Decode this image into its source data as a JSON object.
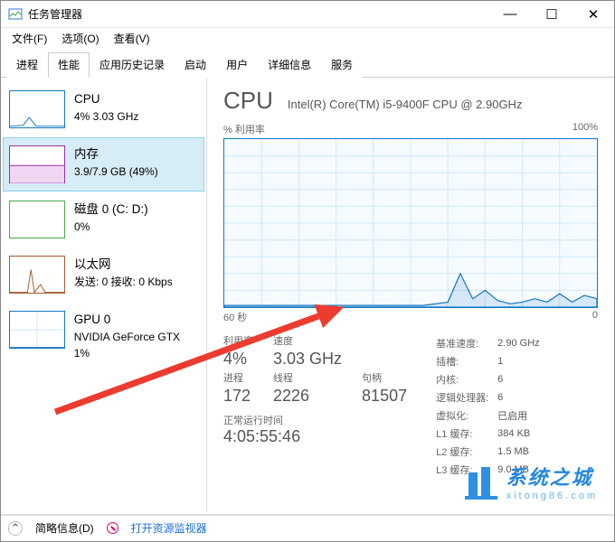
{
  "window": {
    "title": "任务管理器",
    "min": "—",
    "max": "☐",
    "close": "✕"
  },
  "menu": {
    "file": "文件(F)",
    "options": "选项(O)",
    "view": "查看(V)"
  },
  "tabs": [
    "进程",
    "性能",
    "应用历史记录",
    "启动",
    "用户",
    "详细信息",
    "服务"
  ],
  "active_tab": 1,
  "sidebar": [
    {
      "name": "CPU",
      "sub": "4% 3.03 GHz"
    },
    {
      "name": "内存",
      "sub": "3.9/7.9 GB (49%)"
    },
    {
      "name": "磁盘 0 (C: D:)",
      "sub": "0%"
    },
    {
      "name": "以太网",
      "sub": "发送: 0 接收: 0 Kbps"
    },
    {
      "name": "GPU 0",
      "sub": "NVIDIA GeForce GTX 1%"
    }
  ],
  "cpu": {
    "title": "CPU",
    "model": "Intel(R) Core(TM) i5-9400F CPU @ 2.90GHz",
    "util_label": "% 利用率",
    "util_max": "100%",
    "time_span": "60 秒",
    "time_zero": "0"
  },
  "stats": {
    "util_l": "利用率",
    "util_v": "4%",
    "speed_l": "速度",
    "speed_v": "3.03 GHz",
    "proc_l": "进程",
    "proc_v": "172",
    "thread_l": "线程",
    "thread_v": "2226",
    "handle_l": "句柄",
    "handle_v": "81507",
    "uptime_l": "正常运行时间",
    "uptime_v": "4:05:55:46"
  },
  "right": {
    "base_l": "基准速度:",
    "base_v": "2.90 GHz",
    "sock_l": "插槽:",
    "sock_v": "1",
    "cores_l": "内核:",
    "cores_v": "6",
    "lproc_l": "逻辑处理器:",
    "lproc_v": "6",
    "virt_l": "虚拟化:",
    "virt_v": "已启用",
    "l1_l": "L1 缓存:",
    "l1_v": "384 KB",
    "l2_l": "L2 缓存:",
    "l2_v": "1.5 MB",
    "l3_l": "L3 缓存:",
    "l3_v": "9.0 MB"
  },
  "status": {
    "brief": "简略信息(D)",
    "rmon": "打开资源监视器"
  },
  "watermark": {
    "big": "系统之城",
    "small": "xitong86.com"
  },
  "chart_data": {
    "type": "line",
    "title": "% 利用率",
    "xlabel": "60 秒",
    "ylabel": "% 利用率",
    "xlim": [
      0,
      60
    ],
    "ylim": [
      0,
      100
    ],
    "x": [
      0,
      4,
      8,
      12,
      16,
      20,
      24,
      28,
      32,
      36,
      38,
      40,
      42,
      44,
      46,
      48,
      50,
      52,
      54,
      56,
      58,
      60
    ],
    "values": [
      1,
      1,
      1,
      1,
      1,
      1,
      1,
      1,
      1,
      3,
      20,
      5,
      10,
      4,
      2,
      3,
      5,
      3,
      8,
      3,
      7,
      5
    ]
  }
}
